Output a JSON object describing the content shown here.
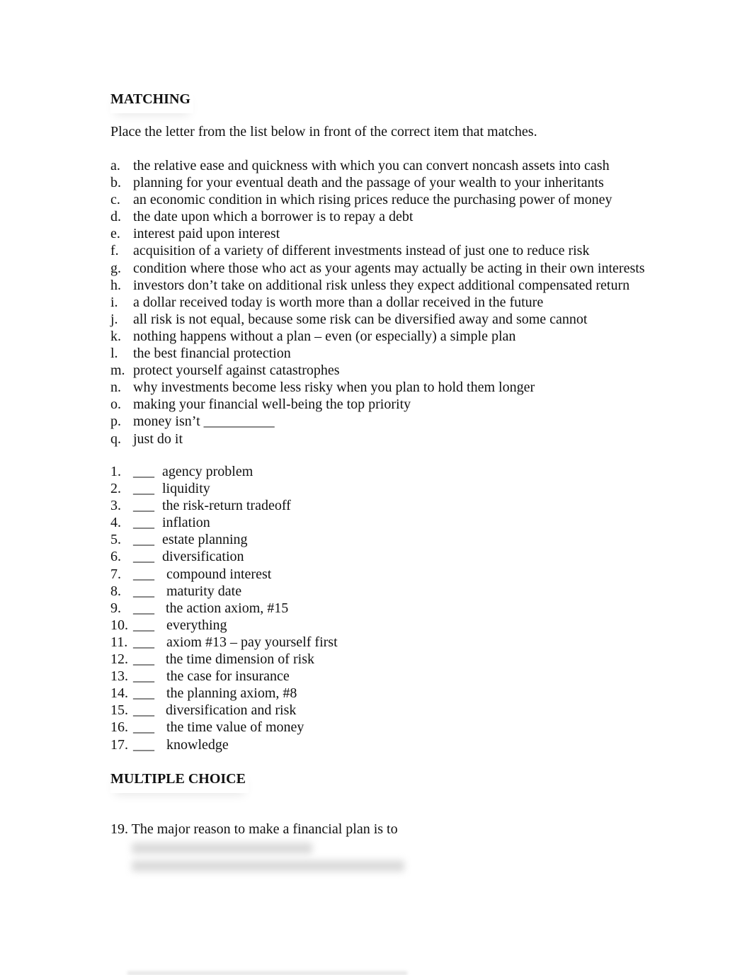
{
  "matching": {
    "heading": "MATCHING",
    "instructions": "Place the letter from the list below in front of the correct item that matches.",
    "definitions": [
      {
        "letter": "a.",
        "text": "the relative ease and quickness with which you can convert noncash assets into cash"
      },
      {
        "letter": "b.",
        "text": "planning for your eventual death and the passage of your wealth to your inheritants"
      },
      {
        "letter": "c.",
        "text": "an economic condition in which rising prices reduce the purchasing power of money"
      },
      {
        "letter": "d.",
        "text": "the date upon which a borrower is to repay a debt"
      },
      {
        "letter": "e.",
        "text": "interest paid upon interest"
      },
      {
        "letter": "f.",
        "text": "acquisition of a variety of different investments instead of just one to reduce risk"
      },
      {
        "letter": "g.",
        "text": "condition where those who act as your agents may actually be acting in their own interests"
      },
      {
        "letter": "h.",
        "text": "investors don’t take on additional risk unless they expect additional compensated return"
      },
      {
        "letter": "i.",
        "text": "a dollar received today is worth more than a dollar received in the future"
      },
      {
        "letter": "j.",
        "text": "all risk is not equal, because some risk can be diversified away and some cannot"
      },
      {
        "letter": "k.",
        "text": "nothing happens without a plan – even  (or especially) a simple plan"
      },
      {
        "letter": "l.",
        "text": "the best financial protection"
      },
      {
        "letter": "m.",
        "text": "protect yourself against catastrophes"
      },
      {
        "letter": "n.",
        "text": "why investments become less risky when you plan to hold them longer"
      },
      {
        "letter": "o.",
        "text": "making your financial well-being the top priority"
      },
      {
        "letter": "p.",
        "text": "money isn’t __________"
      },
      {
        "letter": "q.",
        "text": "just do it"
      }
    ],
    "terms": [
      {
        "number": "1.",
        "blank": "___",
        "term": "agency problem"
      },
      {
        "number": "2.",
        "blank": "___",
        "term": "liquidity"
      },
      {
        "number": "3.",
        "blank": "___",
        "term": "the risk-return tradeoff"
      },
      {
        "number": "4.",
        "blank": "___",
        "term": "inflation"
      },
      {
        "number": "5.",
        "blank": "___",
        "term": "estate planning"
      },
      {
        "number": "6.",
        "blank": "___",
        "term": "diversification"
      },
      {
        "number": "7.",
        "blank": "___",
        "term": "compound interest"
      },
      {
        "number": "8.",
        "blank": "___",
        "term": "maturity date"
      },
      {
        "number": "9.",
        "blank": "___",
        "term": "the action axiom, #15"
      },
      {
        "number": "10.",
        "blank": "___",
        "term": "everything"
      },
      {
        "number": "11.",
        "blank": "___",
        "term": "axiom #13 – pay yourself first"
      },
      {
        "number": "12.",
        "blank": "___",
        "term": "the time dimension of risk"
      },
      {
        "number": "13.",
        "blank": "___",
        "term": "the case for insurance"
      },
      {
        "number": "14.",
        "blank": "___",
        "term": "the planning axiom, #8"
      },
      {
        "number": "15.",
        "blank": "___",
        "term": "diversification and risk"
      },
      {
        "number": "16.",
        "blank": "___",
        "term": "the time value of money"
      },
      {
        "number": "17.",
        "blank": "___",
        "term": "knowledge"
      }
    ]
  },
  "multiple_choice": {
    "heading": "MULTIPLE CHOICE",
    "question": "19. The major reason to make a financial plan is to"
  }
}
